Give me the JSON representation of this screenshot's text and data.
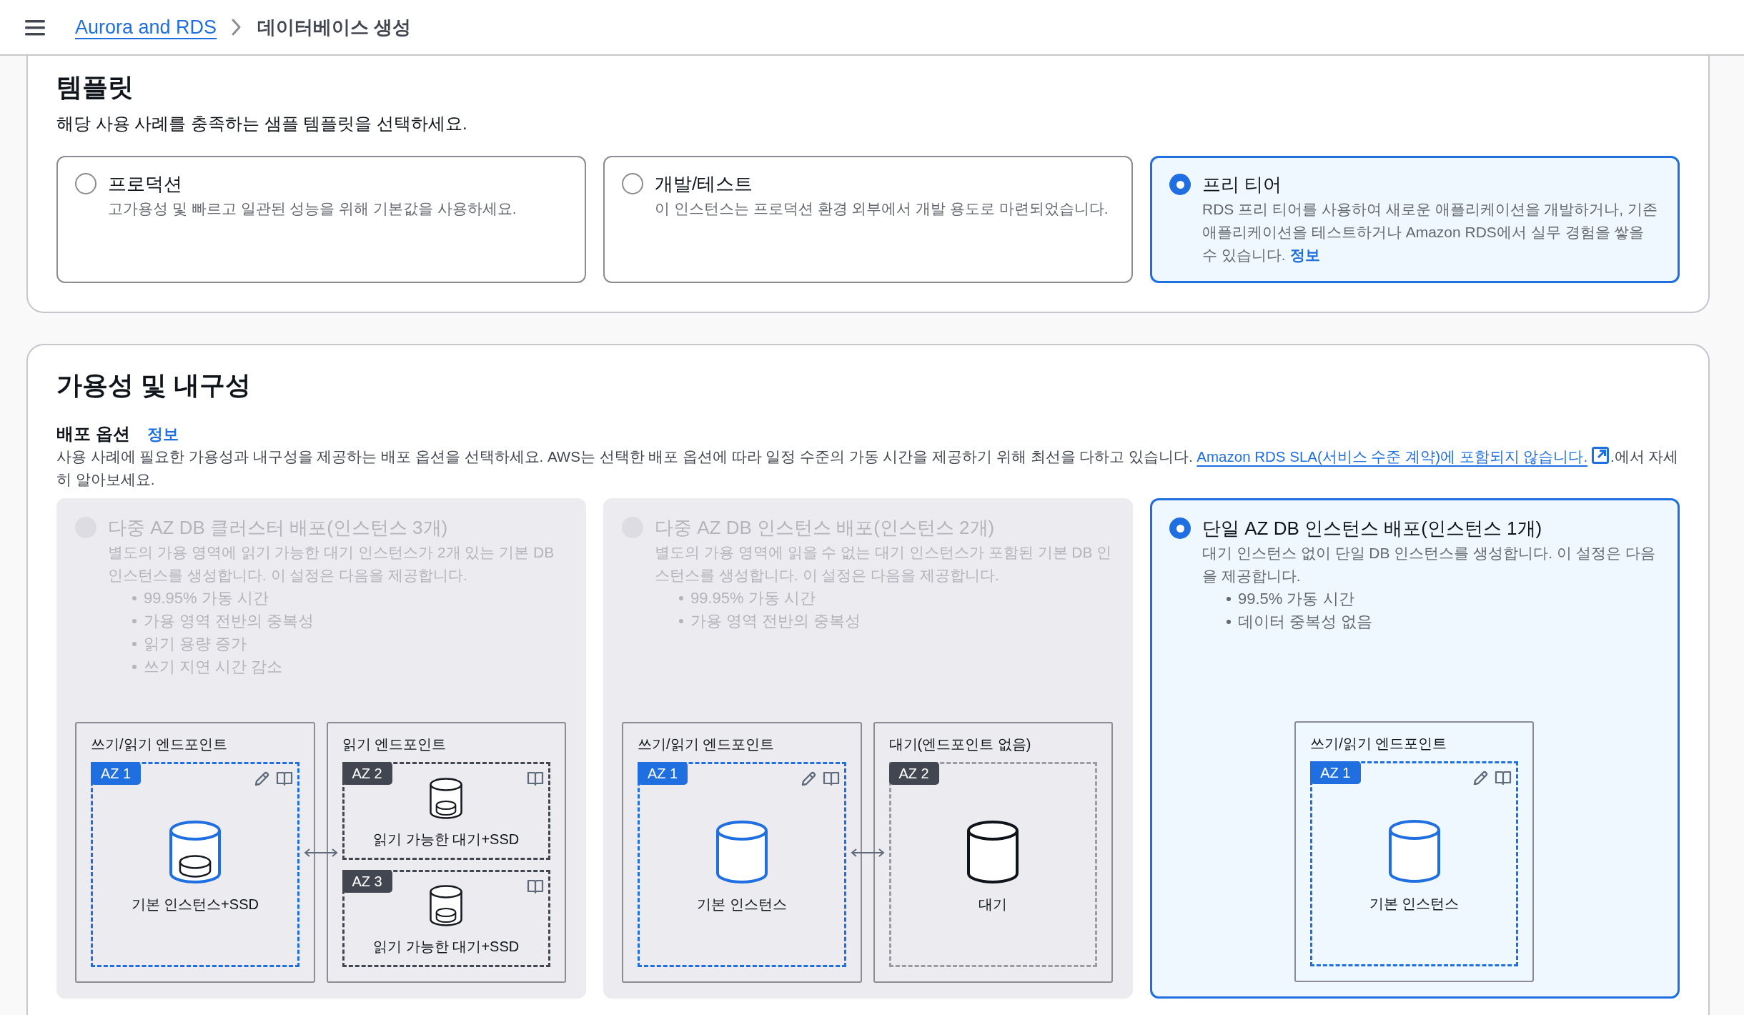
{
  "breadcrumb": {
    "link": "Aurora and RDS",
    "current": "데이터베이스 생성"
  },
  "template": {
    "title": "템플릿",
    "description": "해당 사용 사례를 충족하는 샘플 템플릿을 선택하세요.",
    "options": [
      {
        "title": "프로덕션",
        "description": "고가용성 및 빠르고 일관된 성능을 위해 기본값을 사용하세요.",
        "selected": false
      },
      {
        "title": "개발/테스트",
        "description": "이 인스턴스는 프로덕션 환경 외부에서 개발 용도로 마련되었습니다.",
        "selected": false
      },
      {
        "title": "프리 티어",
        "description": "RDS 프리 티어를 사용하여 새로운 애플리케이션을 개발하거나, 기존 애플리케이션을 테스트하거나 Amazon RDS에서 실무 경험을 쌓을 수 있습니다.",
        "info_link": "정보",
        "selected": true
      }
    ]
  },
  "availability": {
    "title": "가용성 및 내구성",
    "deployment": {
      "label": "배포 옵션",
      "info_link": "정보",
      "description": "사용 사례에 필요한 가용성과 내구성을 제공하는 배포 옵션을 선택하세요. AWS는 선택한 배포 옵션에 따라 일정 수준의 가동 시간을 제공하기 위해 최선을 다하고 있습니다.",
      "sla_link": "Amazon RDS SLA(서비스 수준 계약)에 포함되지 않습니다.",
      "description_end": ".에서 자세히 알아보세요.",
      "options": [
        {
          "title": "다중 AZ DB 클러스터 배포(인스턴스 3개)",
          "description": "별도의 가용 영역에 읽기 가능한 대기 인스턴스가 2개 있는 기본 DB 인스턴스를 생성합니다. 이 설정은 다음을 제공합니다.",
          "bullets": [
            "99.95% 가동 시간",
            "가용 영역 전반의 중복성",
            "읽기 용량 증가",
            "쓰기 지연 시간 감소"
          ],
          "selected": false,
          "disabled": true,
          "diagram": {
            "connector": true,
            "zones": [
              {
                "label": "쓰기/읽기 엔드포인트",
                "azs": [
                  {
                    "badge": "AZ 1",
                    "kind": "primary",
                    "ssd": true,
                    "caption": "기본 인스턴스+SSD"
                  }
                ]
              },
              {
                "label": "읽기 엔드포인트",
                "azs": [
                  {
                    "badge": "AZ 2",
                    "kind": "readable",
                    "ssd": true,
                    "caption": "읽기 가능한 대기+SSD"
                  },
                  {
                    "badge": "AZ 3",
                    "kind": "readable",
                    "ssd": true,
                    "caption": "읽기 가능한 대기+SSD"
                  }
                ]
              }
            ]
          }
        },
        {
          "title": "다중 AZ DB 인스턴스 배포(인스턴스 2개)",
          "description": "별도의 가용 영역에 읽을 수 없는 대기 인스턴스가 포함된 기본 DB 인스턴스를 생성합니다. 이 설정은 다음을 제공합니다.",
          "bullets": [
            "99.95% 가동 시간",
            "가용 영역 전반의 중복성"
          ],
          "selected": false,
          "disabled": true,
          "diagram": {
            "connector": true,
            "zones": [
              {
                "label": "쓰기/읽기 엔드포인트",
                "azs": [
                  {
                    "badge": "AZ 1",
                    "kind": "primary",
                    "ssd": false,
                    "caption": "기본 인스턴스"
                  }
                ]
              },
              {
                "label": "대기(엔드포인트 없음)",
                "azs": [
                  {
                    "badge": "AZ 2",
                    "kind": "standby",
                    "ssd": false,
                    "caption": "대기"
                  }
                ]
              }
            ]
          }
        },
        {
          "title": "단일 AZ DB 인스턴스 배포(인스턴스 1개)",
          "description": "대기 인스턴스 없이 단일 DB 인스턴스를 생성합니다. 이 설정은 다음을 제공합니다.",
          "bullets": [
            "99.5% 가동 시간",
            "데이터 중복성 없음"
          ],
          "selected": true,
          "disabled": false,
          "diagram": {
            "connector": false,
            "zones": [
              {
                "label": "쓰기/읽기 엔드포인트",
                "azs": [
                  {
                    "badge": "AZ 1",
                    "kind": "primary",
                    "ssd": false,
                    "caption": "기본 인스턴스"
                  }
                ]
              }
            ]
          }
        }
      ]
    }
  }
}
